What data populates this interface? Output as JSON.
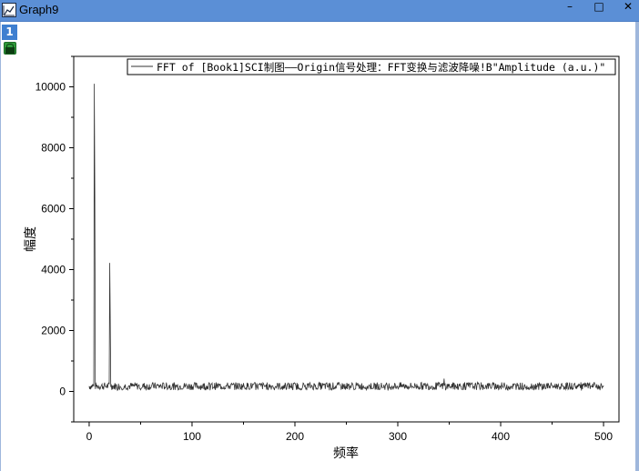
{
  "window": {
    "title": "Graph9",
    "icon": "graph-window-icon",
    "controls": {
      "minimize": "–",
      "maximize": "□",
      "close": "✕"
    }
  },
  "layer_tab": {
    "label": "1"
  },
  "lock_icon": "lock-icon",
  "colors": {
    "titlebar": "#5b8fd6",
    "layer_tab": "#3f7fd0",
    "series": "#333333"
  },
  "chart_data": {
    "type": "line",
    "xlabel": "频率",
    "ylabel": "幅度",
    "xlim": [
      -15,
      515
    ],
    "ylim": [
      -1000,
      11000
    ],
    "xticks": [
      0,
      100,
      200,
      300,
      400,
      500
    ],
    "yticks": [
      0,
      2000,
      4000,
      6000,
      8000,
      10000
    ],
    "grid": false,
    "legend": {
      "placement": "top-right",
      "entries": [
        "FFT of [Book1]SCI制图——Origin信号处理：FFT变换与滤波降噪!B\"Amplitude (a.u.)\""
      ]
    },
    "series": [
      {
        "name": "FFT of [Book1]SCI制图——Origin信号处理：FFT变换与滤波降噪!B\"Amplitude (a.u.)\"",
        "baseline_range": [
          50,
          300
        ],
        "x_step": 0.5,
        "x_start": 0,
        "x_end": 500,
        "peaks": [
          {
            "x": 5,
            "y": 10100
          },
          {
            "x": 5.5,
            "y": 6450
          },
          {
            "x": 20,
            "y": 4220
          },
          {
            "x": 20.5,
            "y": 2380
          },
          {
            "x": 345,
            "y": 420
          }
        ]
      }
    ]
  }
}
